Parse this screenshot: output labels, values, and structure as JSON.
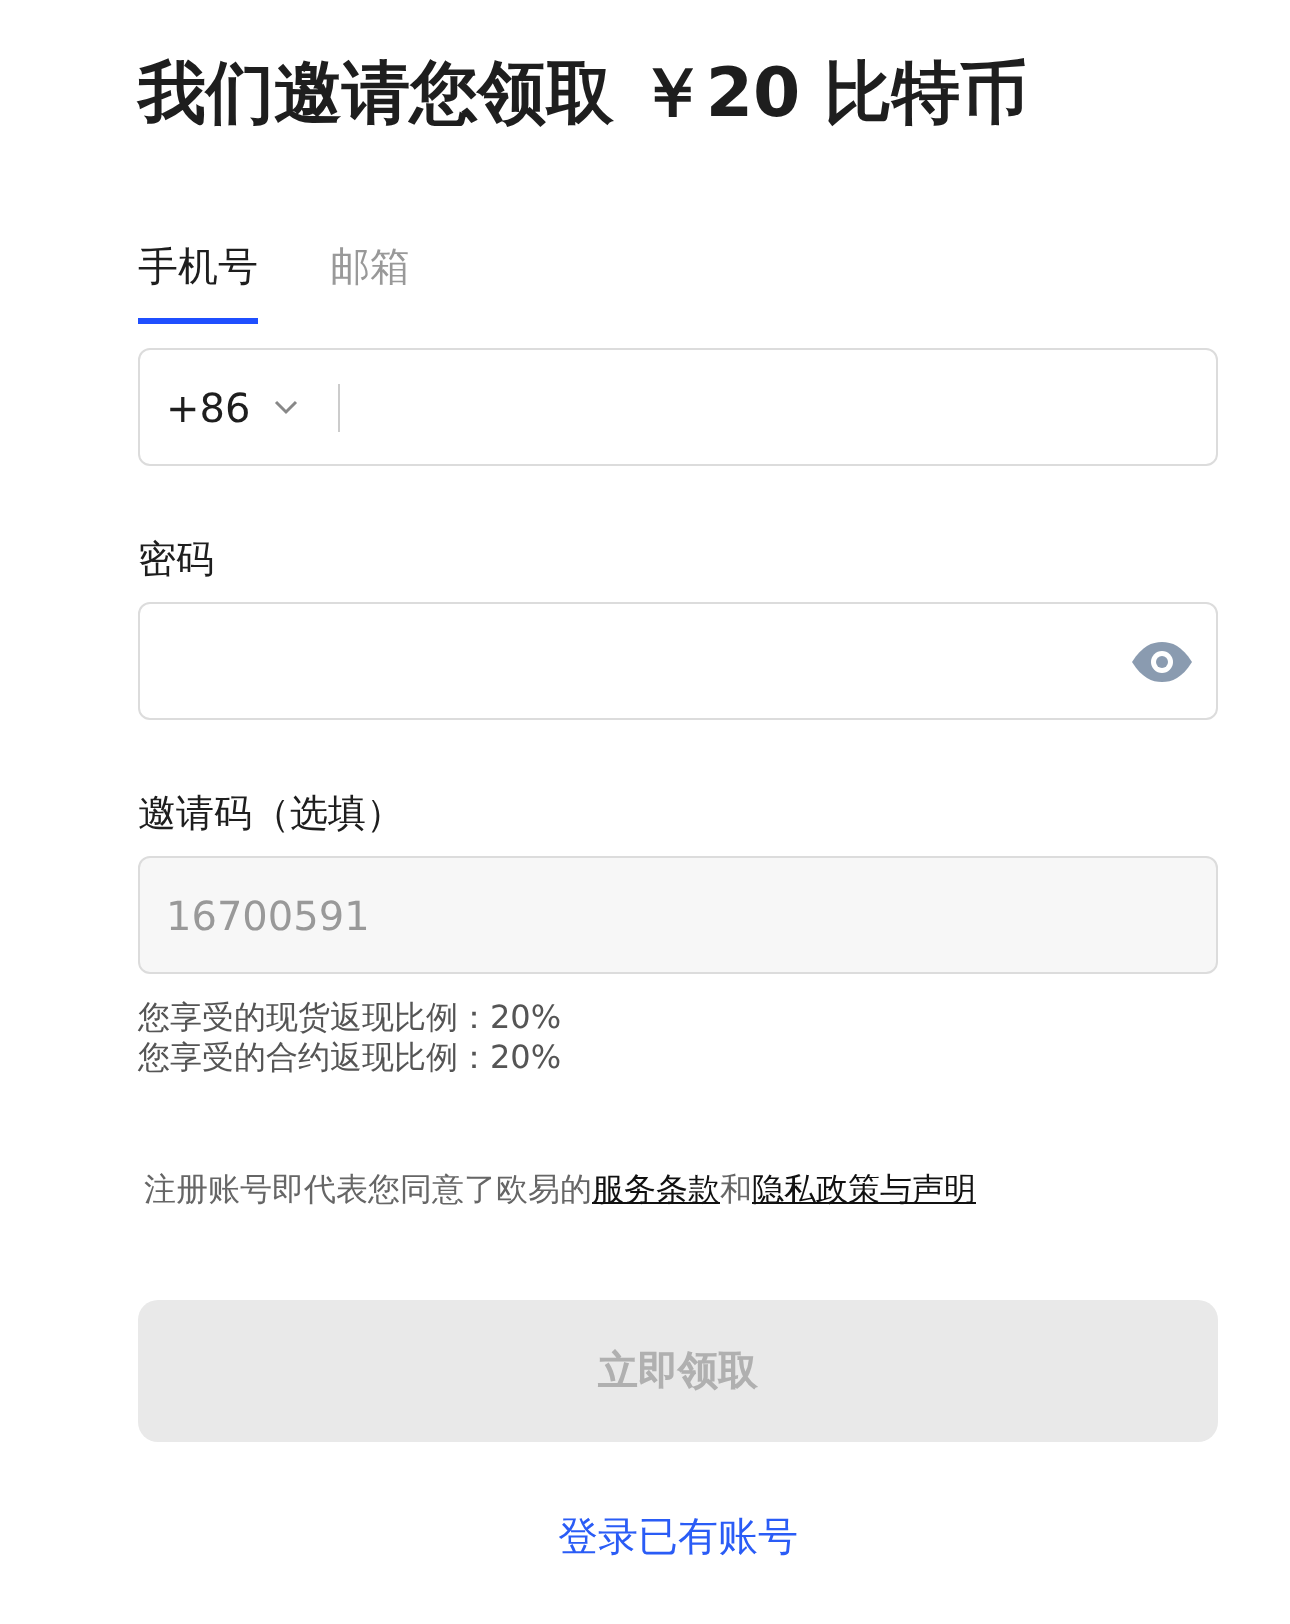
{
  "title": "我们邀请您领取 ￥20 比特币",
  "tabs": [
    {
      "label": "手机号",
      "selected": true
    },
    {
      "label": "邮箱",
      "selected": false
    }
  ],
  "phone": {
    "country_code": "+86"
  },
  "password": {
    "label": "密码"
  },
  "invite": {
    "label": "邀请码（选填）",
    "value": "16700591",
    "disabled": true
  },
  "rebates": [
    "您享受的现货返现比例：20%",
    "您享受的合约返现比例：20%"
  ],
  "terms": {
    "text": "注册账号即代表您同意了欧易的",
    "link_1": "服务条款",
    "joiner": "和",
    "link_2": "隐私政策与声明"
  },
  "submit": {
    "label": "立即领取",
    "disabled": true
  },
  "login_link": "登录已有账号"
}
